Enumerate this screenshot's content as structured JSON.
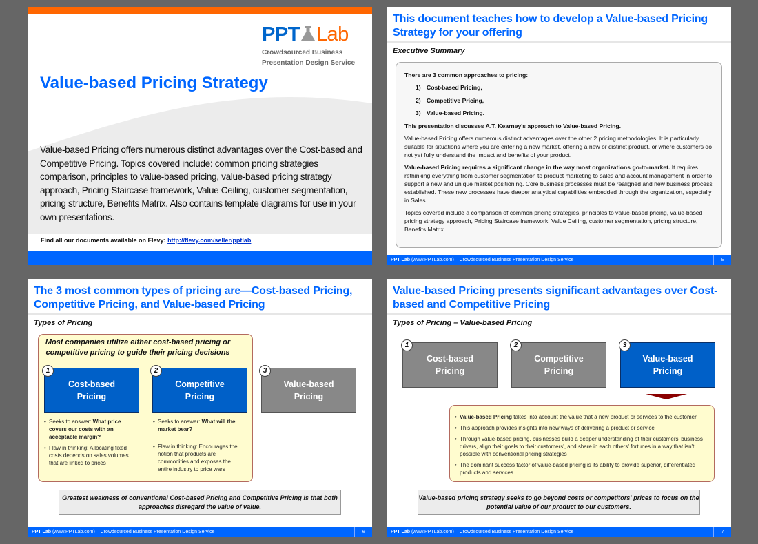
{
  "slides": {
    "s1": {
      "logo": {
        "ppt": "PPT",
        "lab": "Lab",
        "tagline_1": "Crowdsourced Business",
        "tagline_2": "Presentation Design Service"
      },
      "title": "Value-based Pricing Strategy",
      "body": "Value-based Pricing offers numerous distinct advantages over the Cost-based and Competitive Pricing. Topics covered include: common pricing strategies comparison, principles to value-based pricing, value-based pricing strategy approach, Pricing Staircase framework, Value Ceiling, customer segmentation, pricing structure, Benefits Matrix.  Also contains template diagrams for use in your own presentations.",
      "find_label": "Find all our documents available on Flevy:",
      "find_link": "http://flevy.com/seller/pptlab"
    },
    "s2": {
      "title": "This document teaches how to develop a Value-based Pricing Strategy for your offering",
      "subtitle": "Executive Summary",
      "intro": "There are 3 common approaches to pricing:",
      "approaches": [
        {
          "num": "1)",
          "label": "Cost-based Pricing,"
        },
        {
          "num": "2)",
          "label": "Competitive Pricing,"
        },
        {
          "num": "3)",
          "label": "Value-based Pricing."
        }
      ],
      "kearney": "This presentation discusses A.T. Kearney's approach to Value-based Pricing.",
      "para1": "Value-based Pricing offers numerous distinct advantages over the other 2 pricing methodologies.  It is particularly suitable for situations where you are entering a new market, offering a new or distinct product, or where customers do not yet fully understand the impact and benefits of your product.",
      "para2_bold": "Value-based Pricing requires a significant change in the way most organizations go-to-market.",
      "para2_rest": " It requires rethinking everything from customer segmentation to product marketing to sales and account management in order to support a new and unique market positioning.  Core business processes must be realigned and new business process established.  These new processes have deeper analytical capabilities embedded through the organization, especially in Sales.",
      "para3": "Topics covered include a comparison of common pricing strategies, principles to value-based pricing, value-based pricing strategy approach, Pricing Staircase framework, Value Ceiling, customer segmentation, pricing structure, Benefits Matrix.",
      "page": "5"
    },
    "s3": {
      "title": "The 3 most common types of pricing are—Cost-based Pricing, Competitive Pricing, and Value-based Pricing",
      "subtitle": "Types of Pricing",
      "box_head": "Most companies utilize either cost-based pricing or competitive pricing to guide their pricing decisions",
      "types": [
        {
          "num": "1",
          "line1": "Cost-based",
          "line2": "Pricing"
        },
        {
          "num": "2",
          "line1": "Competitive",
          "line2": "Pricing"
        },
        {
          "num": "3",
          "line1": "Value-based",
          "line2": "Pricing"
        }
      ],
      "cost_bullets": {
        "b1_pre": "Seeks to answer: ",
        "b1_bold": "What price covers our costs with an acceptable margin?",
        "b2": "Flaw in thinking: Allocating fixed costs depends on sales volumes that are linked to prices"
      },
      "comp_bullets": {
        "b1_pre": "Seeks to answer: ",
        "b1_bold": "What will the market bear?",
        "b2": "Flaw in thinking: Encourages the notion that products are commodities and exposes the entire industry to price wars"
      },
      "callout_1": "Greatest weakness of conventional Cost-based Pricing and Competitive Pricing is that both approaches disregard the ",
      "callout_u": "value of value",
      "callout_2": ".",
      "page": "6"
    },
    "s4": {
      "title": "Value-based Pricing presents significant advantages over Cost-based and Competitive Pricing",
      "subtitle": "Types of Pricing – Value-based Pricing",
      "types": [
        {
          "num": "1",
          "line1": "Cost-based",
          "line2": "Pricing"
        },
        {
          "num": "2",
          "line1": "Competitive",
          "line2": "Pricing"
        },
        {
          "num": "3",
          "line1": "Value-based",
          "line2": "Pricing"
        }
      ],
      "b1_bold": "Value-based Pricing",
      "b1_rest": " takes into account the value that a new product or services to the customer",
      "b2": "This approach provides insights into new ways of delivering a product or service",
      "b3": "Through value-based pricing, businesses build a deeper understanding of their customers' business drivers, align their goals to their customers', and share in each others' fortunes in a way that isn't possible with conventional pricing strategies",
      "b4": "The dominant success factor of value-based pricing is its ability to provide superior, differentiated products and services",
      "callout": "Value-based pricing strategy seeks to go beyond costs or competitors' prices to focus on the potential value of our product to our customers.",
      "page": "7"
    }
  },
  "footer": {
    "brand": "PPT Lab",
    "rest": " (www.PPTLab.com) – Crowdsourced Business Presentation Design Service"
  },
  "colors": {
    "accent_blue": "#0066ff",
    "orange": "#ff6600",
    "box_blue": "#0060c8",
    "box_gray": "#888888",
    "yellow": "#fffccf",
    "arrow": "#8b0000"
  }
}
